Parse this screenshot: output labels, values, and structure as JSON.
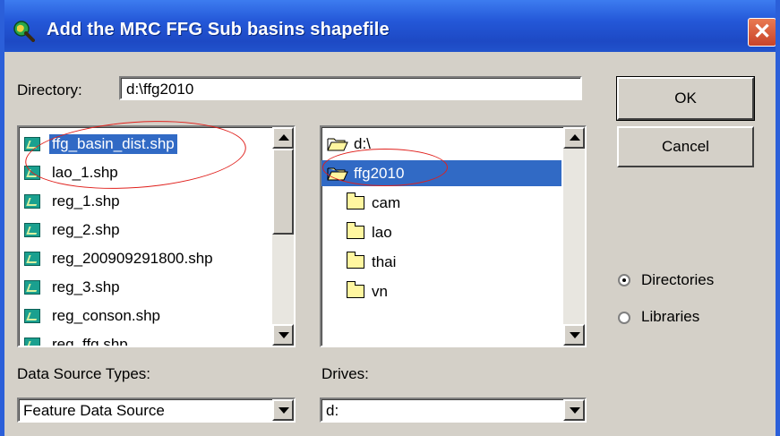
{
  "window": {
    "title": "Add the MRC FFG Sub basins shapefile",
    "close_glyph": "✕"
  },
  "directory": {
    "label": "Directory:",
    "value": "d:\\ffg2010"
  },
  "buttons": {
    "ok": "OK",
    "cancel": "Cancel"
  },
  "file_list": {
    "items": [
      {
        "name": "ffg_basin_dist.shp",
        "selected": true
      },
      {
        "name": "lao_1.shp",
        "selected": false
      },
      {
        "name": "reg_1.shp",
        "selected": false
      },
      {
        "name": "reg_2.shp",
        "selected": false
      },
      {
        "name": "reg_200909291800.shp",
        "selected": false
      },
      {
        "name": "reg_3.shp",
        "selected": false
      },
      {
        "name": "reg_conson.shp",
        "selected": false
      },
      {
        "name": "reg_ffg.shp",
        "selected": false
      }
    ]
  },
  "dir_tree": {
    "items": [
      {
        "name": "d:\\",
        "kind": "open-folder",
        "selected": false
      },
      {
        "name": "ffg2010",
        "kind": "open-folder",
        "selected": true
      },
      {
        "name": "cam",
        "kind": "folder",
        "selected": false
      },
      {
        "name": "lao",
        "kind": "folder",
        "selected": false
      },
      {
        "name": "thai",
        "kind": "folder",
        "selected": false
      },
      {
        "name": "vn",
        "kind": "folder",
        "selected": false
      }
    ]
  },
  "mode": {
    "directories": "Directories",
    "libraries": "Libraries",
    "selected": "directories"
  },
  "data_source": {
    "label": "Data Source Types:",
    "value": "Feature Data Source"
  },
  "drives": {
    "label": "Drives:",
    "value": "d:"
  },
  "colors": {
    "selection": "#316ac5",
    "annotation": "#e0201c",
    "titlebar": "#2458d8"
  }
}
